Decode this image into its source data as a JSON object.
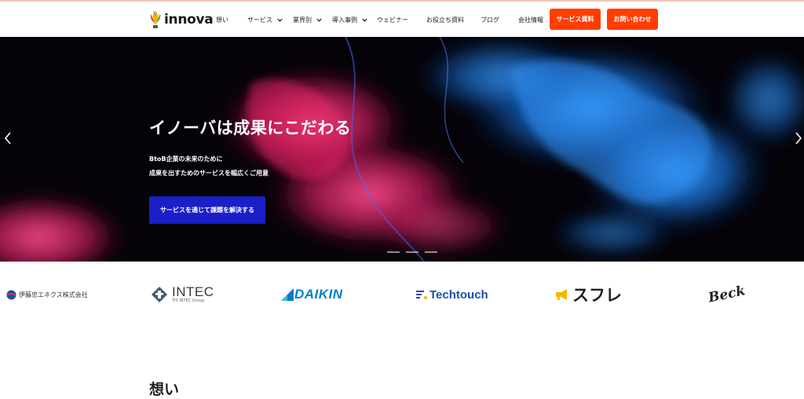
{
  "brand": {
    "name": "innova"
  },
  "nav": {
    "items": [
      {
        "label": "想い",
        "has_dropdown": false
      },
      {
        "label": "サービス",
        "has_dropdown": true
      },
      {
        "label": "業界別",
        "has_dropdown": true
      },
      {
        "label": "導入事例",
        "has_dropdown": true
      },
      {
        "label": "ウェビナー",
        "has_dropdown": false
      },
      {
        "label": "お役立ち資料",
        "has_dropdown": false
      },
      {
        "label": "ブログ",
        "has_dropdown": false
      },
      {
        "label": "会社情報",
        "has_dropdown": false
      }
    ],
    "service_doc_button": "サービス資料",
    "contact_button": "お問い合わせ"
  },
  "hero": {
    "title": "イノーバは成果にこだわる",
    "subtitle_line1": "BtoB企業の未来のために",
    "subtitle_line2": "成果を出すためのサービスを幅広くご用意",
    "cta_label": "サービスを通じて課題を解決する",
    "slide_count": 3
  },
  "clients": [
    {
      "name": "伊藤忠エネクス株式会社"
    },
    {
      "name": "INTEC",
      "sub": "TIS INTEC Group"
    },
    {
      "name": "DAIKIN"
    },
    {
      "name": "Techtouch"
    },
    {
      "name": "スフレ"
    },
    {
      "name": "Beck"
    }
  ],
  "section": {
    "title": "想い"
  },
  "colors": {
    "accent": "#ff3d00",
    "cta": "#1a1fc8",
    "daikin": "#0080c8",
    "techtouch": "#1f4fa8"
  }
}
